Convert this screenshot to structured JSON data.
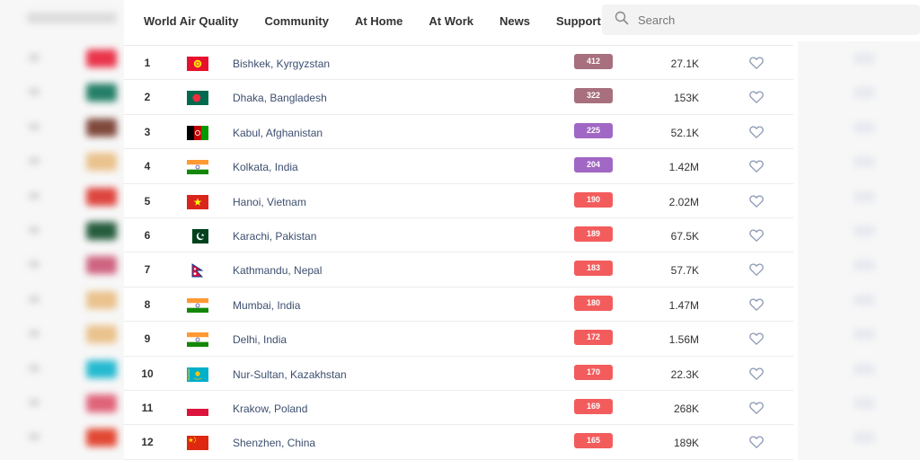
{
  "nav": {
    "items": [
      {
        "label": "World Air Quality"
      },
      {
        "label": "Community"
      },
      {
        "label": "At Home"
      },
      {
        "label": "At Work"
      },
      {
        "label": "News"
      },
      {
        "label": "Support"
      }
    ]
  },
  "search": {
    "placeholder": "Search",
    "icon": "search-icon"
  },
  "colors": {
    "hazardous": "#a86f7e",
    "very_unhealthy": "#a167c4",
    "unhealthy": "#f35c5c"
  },
  "rows": [
    {
      "rank": "1",
      "city": "Bishkek, Kyrgyzstan",
      "aqi": "412",
      "followers": "27.1K",
      "flag": "kyrgyzstan",
      "aqi_color": "#a86f7e"
    },
    {
      "rank": "2",
      "city": "Dhaka, Bangladesh",
      "aqi": "322",
      "followers": "153K",
      "flag": "bangladesh",
      "aqi_color": "#a86f7e"
    },
    {
      "rank": "3",
      "city": "Kabul, Afghanistan",
      "aqi": "225",
      "followers": "52.1K",
      "flag": "afghanistan",
      "aqi_color": "#a167c4"
    },
    {
      "rank": "4",
      "city": "Kolkata, India",
      "aqi": "204",
      "followers": "1.42M",
      "flag": "india",
      "aqi_color": "#a167c4"
    },
    {
      "rank": "5",
      "city": "Hanoi, Vietnam",
      "aqi": "190",
      "followers": "2.02M",
      "flag": "vietnam",
      "aqi_color": "#f35c5c"
    },
    {
      "rank": "6",
      "city": "Karachi, Pakistan",
      "aqi": "189",
      "followers": "67.5K",
      "flag": "pakistan",
      "aqi_color": "#f35c5c"
    },
    {
      "rank": "7",
      "city": "Kathmandu, Nepal",
      "aqi": "183",
      "followers": "57.7K",
      "flag": "nepal",
      "aqi_color": "#f35c5c"
    },
    {
      "rank": "8",
      "city": "Mumbai, India",
      "aqi": "180",
      "followers": "1.47M",
      "flag": "india",
      "aqi_color": "#f35c5c"
    },
    {
      "rank": "9",
      "city": "Delhi, India",
      "aqi": "172",
      "followers": "1.56M",
      "flag": "india",
      "aqi_color": "#f35c5c"
    },
    {
      "rank": "10",
      "city": "Nur-Sultan, Kazakhstan",
      "aqi": "170",
      "followers": "22.3K",
      "flag": "kazakhstan",
      "aqi_color": "#f35c5c"
    },
    {
      "rank": "11",
      "city": "Krakow, Poland",
      "aqi": "169",
      "followers": "268K",
      "flag": "poland",
      "aqi_color": "#f35c5c"
    },
    {
      "rank": "12",
      "city": "Shenzhen, China",
      "aqi": "165",
      "followers": "189K",
      "flag": "china",
      "aqi_color": "#f35c5c"
    }
  ]
}
